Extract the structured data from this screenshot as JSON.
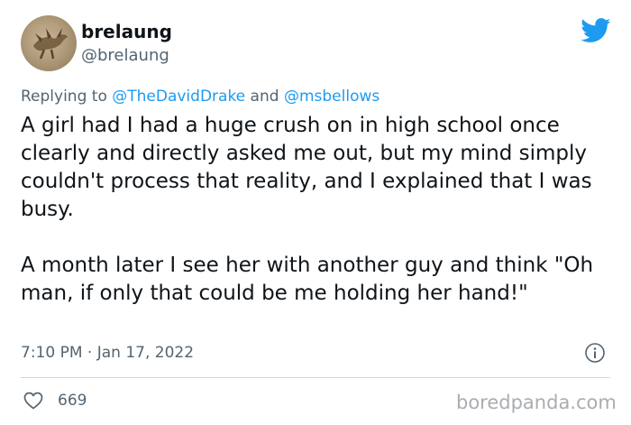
{
  "user": {
    "display_name": "brelaung",
    "handle": "@brelaung",
    "avatar_icon": "avatar-image"
  },
  "reply": {
    "prefix": "Replying to ",
    "mention1": "@TheDavidDrake",
    "conjunction": " and ",
    "mention2": "@msbellows"
  },
  "tweet": {
    "paragraph1": "A girl had I had a huge crush on in high school once clearly and directly asked me out, but my mind simply couldn't process that reality, and I explained that I was busy.",
    "paragraph2": "A month later I see her with another guy and think \"Oh man, if only that could be me holding her hand!\"",
    "time": "7:10 PM",
    "separator": " · ",
    "date": "Jan 17, 2022"
  },
  "actions": {
    "likes": "669"
  },
  "icons": {
    "brand": "twitter-bird-icon",
    "info": "info-icon",
    "like": "heart-icon"
  },
  "colors": {
    "accent": "#1d9bf0",
    "text": "#0f1419",
    "secondary": "#536471",
    "watermark": "#a9adb1"
  },
  "watermark": "boredpanda.com"
}
